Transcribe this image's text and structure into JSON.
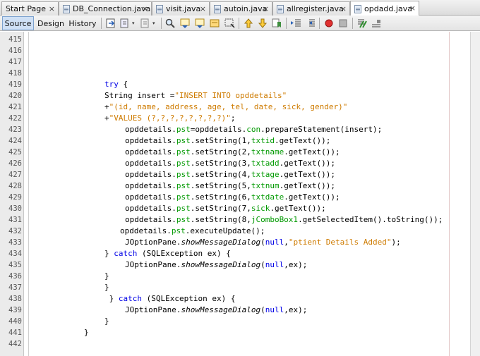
{
  "tabs": [
    {
      "label": "Start Page",
      "active": false,
      "icon": "start-page-icon"
    },
    {
      "label": "DB_Connection.java",
      "active": false,
      "icon": "java-file-icon"
    },
    {
      "label": "visit.java",
      "active": false,
      "icon": "java-file-icon"
    },
    {
      "label": "autoin.java",
      "active": false,
      "icon": "java-file-icon"
    },
    {
      "label": "allregister.java",
      "active": false,
      "icon": "java-file-icon"
    },
    {
      "label": "opdadd.java",
      "active": true,
      "icon": "java-file-icon"
    }
  ],
  "close_glyph": "×",
  "toolbar": {
    "views": [
      {
        "label": "Source",
        "active": true
      },
      {
        "label": "Design",
        "active": false
      },
      {
        "label": "History",
        "active": false
      }
    ],
    "dropdown_glyph": "▾"
  },
  "editor": {
    "lines": [
      {
        "n": "415",
        "indent": 0,
        "tokens": []
      },
      {
        "n": "416",
        "indent": 0,
        "tokens": []
      },
      {
        "n": "417",
        "indent": 0,
        "tokens": []
      },
      {
        "n": "418",
        "indent": 0,
        "tokens": []
      },
      {
        "n": "419",
        "indent": 148,
        "tokens": [
          {
            "t": "try",
            "c": "kw"
          },
          {
            "t": " {"
          }
        ]
      },
      {
        "n": "420",
        "indent": 148,
        "tokens": [
          {
            "t": "String insert ="
          },
          {
            "t": "\"INSERT INTO opddetails\"",
            "c": "str"
          }
        ]
      },
      {
        "n": "421",
        "indent": 148,
        "tokens": [
          {
            "t": "+"
          },
          {
            "t": "\"(id, name, address, age, tel, date, sick, gender)\"",
            "c": "str"
          }
        ]
      },
      {
        "n": "422",
        "indent": 148,
        "tokens": [
          {
            "t": "+"
          },
          {
            "t": "\"VALUES (?,?,?,?,?,?,?,?)\"",
            "c": "str"
          },
          {
            "t": ";"
          }
        ]
      },
      {
        "n": "423",
        "indent": 177,
        "tokens": [
          {
            "t": "opddetails."
          },
          {
            "t": "pst",
            "c": "fld"
          },
          {
            "t": "=opddetails."
          },
          {
            "t": "con",
            "c": "fld"
          },
          {
            "t": ".prepareStatement(insert);"
          }
        ]
      },
      {
        "n": "424",
        "indent": 177,
        "tokens": [
          {
            "t": "opddetails."
          },
          {
            "t": "pst",
            "c": "fld"
          },
          {
            "t": ".setString(1,"
          },
          {
            "t": "txtid",
            "c": "fld"
          },
          {
            "t": ".getText());"
          }
        ]
      },
      {
        "n": "425",
        "indent": 177,
        "tokens": [
          {
            "t": "opddetails."
          },
          {
            "t": "pst",
            "c": "fld"
          },
          {
            "t": ".setString(2,"
          },
          {
            "t": "txtname",
            "c": "fld"
          },
          {
            "t": ".getText());"
          }
        ]
      },
      {
        "n": "426",
        "indent": 177,
        "tokens": [
          {
            "t": "opddetails."
          },
          {
            "t": "pst",
            "c": "fld"
          },
          {
            "t": ".setString(3,"
          },
          {
            "t": "txtadd",
            "c": "fld"
          },
          {
            "t": ".getText());"
          }
        ]
      },
      {
        "n": "427",
        "indent": 177,
        "tokens": [
          {
            "t": "opddetails."
          },
          {
            "t": "pst",
            "c": "fld"
          },
          {
            "t": ".setString(4,"
          },
          {
            "t": "txtage",
            "c": "fld"
          },
          {
            "t": ".getText());"
          }
        ]
      },
      {
        "n": "428",
        "indent": 177,
        "tokens": [
          {
            "t": "opddetails."
          },
          {
            "t": "pst",
            "c": "fld"
          },
          {
            "t": ".setString(5,"
          },
          {
            "t": "txtnum",
            "c": "fld"
          },
          {
            "t": ".getText());"
          }
        ]
      },
      {
        "n": "429",
        "indent": 177,
        "tokens": [
          {
            "t": "opddetails."
          },
          {
            "t": "pst",
            "c": "fld"
          },
          {
            "t": ".setString(6,"
          },
          {
            "t": "txtdate",
            "c": "fld"
          },
          {
            "t": ".getText());"
          }
        ]
      },
      {
        "n": "430",
        "indent": 177,
        "tokens": [
          {
            "t": "opddetails."
          },
          {
            "t": "pst",
            "c": "fld"
          },
          {
            "t": ".setString(7,"
          },
          {
            "t": "sick",
            "c": "fld"
          },
          {
            "t": ".getText());"
          }
        ]
      },
      {
        "n": "431",
        "indent": 177,
        "tokens": [
          {
            "t": "opddetails."
          },
          {
            "t": "pst",
            "c": "fld"
          },
          {
            "t": ".setString(8,"
          },
          {
            "t": "jComboBox1",
            "c": "fld"
          },
          {
            "t": ".getSelectedItem().toString());"
          }
        ]
      },
      {
        "n": "432",
        "indent": 170,
        "tokens": [
          {
            "t": "opddetails."
          },
          {
            "t": "pst",
            "c": "fld"
          },
          {
            "t": ".executeUpdate();"
          }
        ]
      },
      {
        "n": "433",
        "indent": 177,
        "tokens": [
          {
            "t": "JOptionPane."
          },
          {
            "t": "showMessageDialog",
            "c": "it"
          },
          {
            "t": "("
          },
          {
            "t": "null",
            "c": "kw"
          },
          {
            "t": ","
          },
          {
            "t": "\"ptient Details Added\"",
            "c": "str"
          },
          {
            "t": ");"
          }
        ]
      },
      {
        "n": "434",
        "indent": 148,
        "tokens": [
          {
            "t": "} "
          },
          {
            "t": "catch",
            "c": "kw"
          },
          {
            "t": " (SQLException ex) {"
          }
        ]
      },
      {
        "n": "435",
        "indent": 177,
        "tokens": [
          {
            "t": "JOptionPane."
          },
          {
            "t": "showMessageDialog",
            "c": "it"
          },
          {
            "t": "("
          },
          {
            "t": "null",
            "c": "kw"
          },
          {
            "t": ",ex);"
          }
        ]
      },
      {
        "n": "436",
        "indent": 148,
        "tokens": [
          {
            "t": "}"
          }
        ]
      },
      {
        "n": "437",
        "indent": 148,
        "tokens": [
          {
            "t": "}"
          }
        ]
      },
      {
        "n": "438",
        "indent": 148,
        "tokens": [
          {
            "t": " } "
          },
          {
            "t": "catch",
            "c": "kw"
          },
          {
            "t": " (SQLException ex) {"
          }
        ]
      },
      {
        "n": "439",
        "indent": 177,
        "tokens": [
          {
            "t": "JOptionPane."
          },
          {
            "t": "showMessageDialog",
            "c": "it"
          },
          {
            "t": "("
          },
          {
            "t": "null",
            "c": "kw"
          },
          {
            "t": ",ex);"
          }
        ]
      },
      {
        "n": "440",
        "indent": 148,
        "tokens": [
          {
            "t": "}"
          }
        ]
      },
      {
        "n": "441",
        "indent": 119,
        "tokens": [
          {
            "t": "}"
          }
        ]
      },
      {
        "n": "442",
        "indent": 0,
        "tokens": []
      }
    ]
  }
}
